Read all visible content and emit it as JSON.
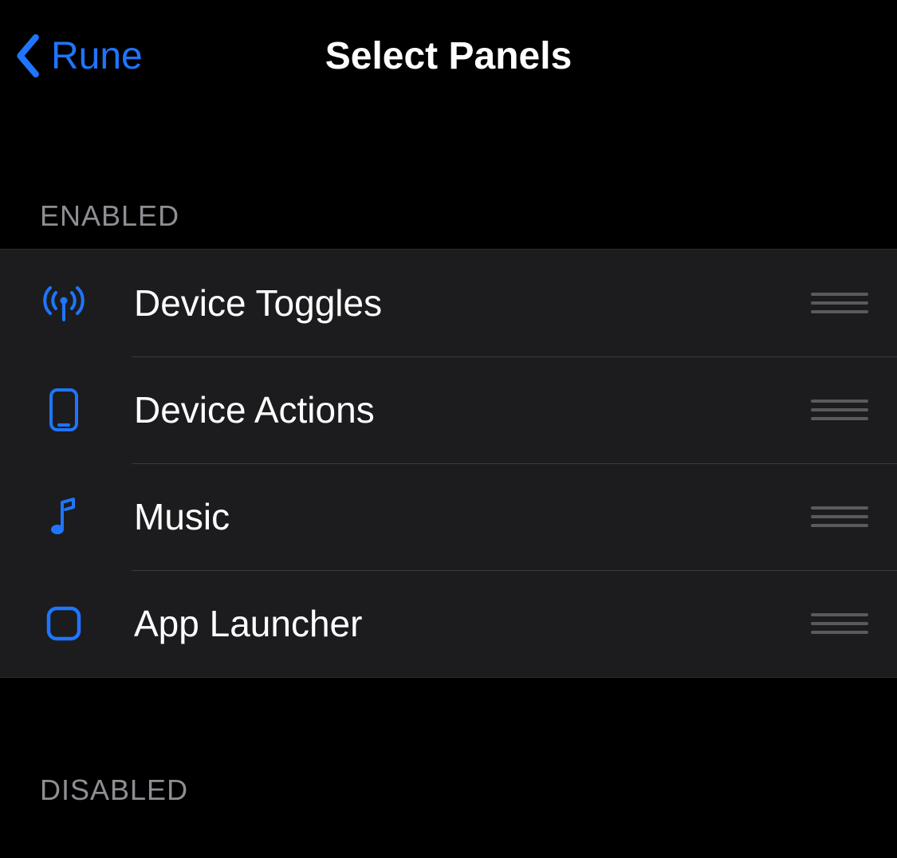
{
  "colors": {
    "accent": "#1f75fe",
    "background": "#000000",
    "cell": "#1c1c1e",
    "separator": "#3a3a3c",
    "secondaryLabel": "#8e8e93",
    "dragHandle": "#5a5a5e"
  },
  "nav": {
    "back_label": "Rune",
    "title": "Select Panels"
  },
  "sections": {
    "enabled": {
      "title": "Enabled",
      "items": [
        {
          "icon": "broadcast-icon",
          "label": "Device Toggles"
        },
        {
          "icon": "phone-icon",
          "label": "Device Actions"
        },
        {
          "icon": "music-icon",
          "label": "Music"
        },
        {
          "icon": "square-icon",
          "label": "App Launcher"
        }
      ]
    },
    "disabled": {
      "title": "Disabled",
      "items": []
    }
  }
}
